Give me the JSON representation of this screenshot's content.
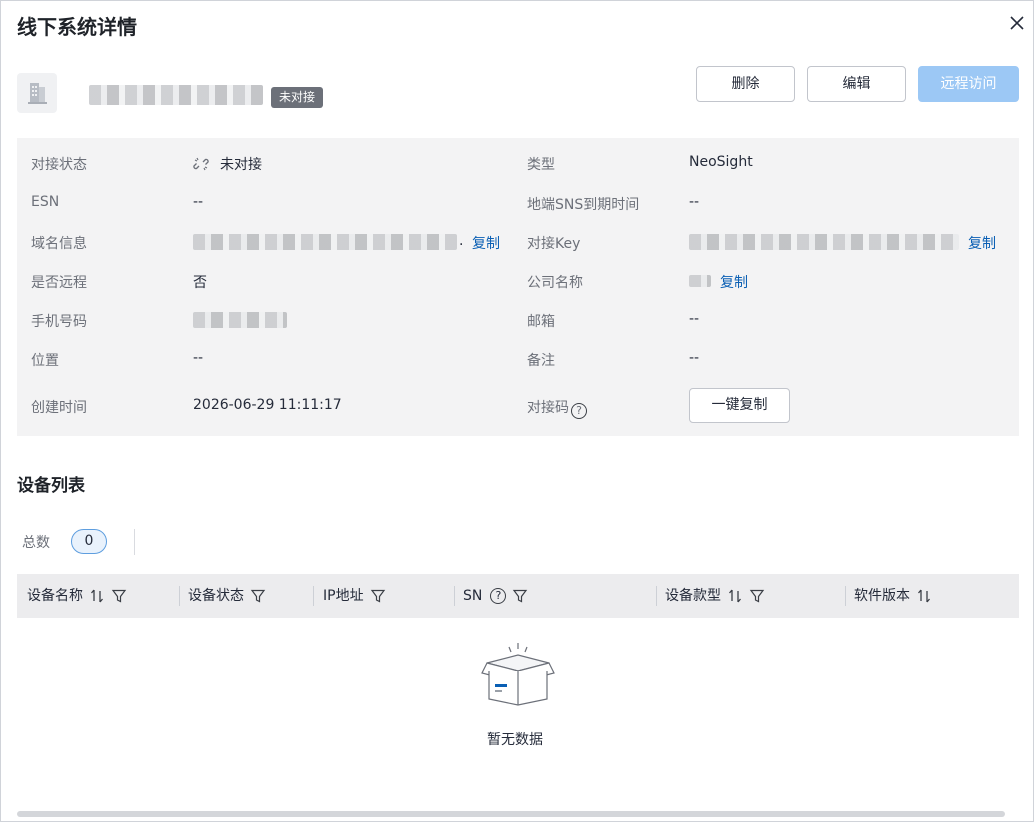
{
  "dialog": {
    "title": "线下系统详情",
    "close_icon": "close-icon"
  },
  "header": {
    "system_icon": "building-icon",
    "status_badge": "未对接",
    "buttons": {
      "delete": "删除",
      "edit": "编辑",
      "remote_access": "远程访问"
    }
  },
  "details": {
    "left": [
      {
        "label": "对接状态",
        "value": "未对接",
        "icon": "unlink-icon"
      },
      {
        "label": "ESN",
        "value": "--"
      },
      {
        "label": "域名信息",
        "value": ".",
        "action": "复制"
      },
      {
        "label": "是否远程",
        "value": "否"
      },
      {
        "label": "手机号码",
        "value": ""
      },
      {
        "label": "位置",
        "value": "--"
      },
      {
        "label": "创建时间",
        "value": "2026-06-29 11:11:17"
      }
    ],
    "right": [
      {
        "label": "类型",
        "value": "NeoSight"
      },
      {
        "label": "地端SNS到期时间",
        "value": "--"
      },
      {
        "label": "对接Key",
        "value": "",
        "action": "复制"
      },
      {
        "label": "公司名称",
        "value": "",
        "action": "复制"
      },
      {
        "label": "邮箱",
        "value": "--"
      },
      {
        "label": "备注",
        "value": "--"
      },
      {
        "label": "对接码",
        "help": "?",
        "button": "一键复制"
      }
    ]
  },
  "device_list": {
    "title": "设备列表",
    "total_label": "总数",
    "total_count": "0",
    "columns": [
      {
        "label": "设备名称",
        "sort": true,
        "filter": true
      },
      {
        "label": "设备状态",
        "sort": false,
        "filter": true
      },
      {
        "label": "IP地址",
        "sort": false,
        "filter": true
      },
      {
        "label": "SN",
        "help": "?",
        "sort": false,
        "filter": true
      },
      {
        "label": "设备款型",
        "sort": true,
        "filter": true
      },
      {
        "label": "软件版本",
        "sort": true,
        "filter": false
      }
    ],
    "empty_text": "暂无数据"
  },
  "colors": {
    "link": "#0a5fb4",
    "primary_disabled": "#9cc8f5",
    "badge_gray": "#6c7079"
  }
}
